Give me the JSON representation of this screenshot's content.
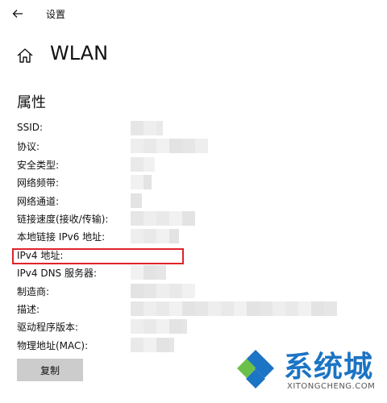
{
  "window": {
    "title": "设置"
  },
  "header": {
    "title": "WLAN",
    "icon": "home-icon"
  },
  "section": {
    "title": "属性"
  },
  "properties": [
    {
      "label": "SSID:"
    },
    {
      "label": "协议:"
    },
    {
      "label": "安全类型:"
    },
    {
      "label": "网络频带:"
    },
    {
      "label": "网络通道:"
    },
    {
      "label": "链接速度(接收/传输):"
    },
    {
      "label": "本地链接 IPv6 地址:"
    },
    {
      "label": "IPv4 地址:"
    },
    {
      "label": "IPv4 DNS 服务器:"
    },
    {
      "label": "制造商:"
    },
    {
      "label": "描述:"
    },
    {
      "label": "驱动程序版本:"
    },
    {
      "label": "物理地址(MAC):"
    }
  ],
  "actions": {
    "copy_label": "复制"
  },
  "watermark": {
    "brand": "系统城",
    "site": "XITONGCHENG.COM"
  },
  "colors": {
    "highlight": "#e0232b",
    "button_bg": "#cccccc",
    "watermark_blue": "#1b74c4",
    "watermark_green": "#6cc04a"
  }
}
